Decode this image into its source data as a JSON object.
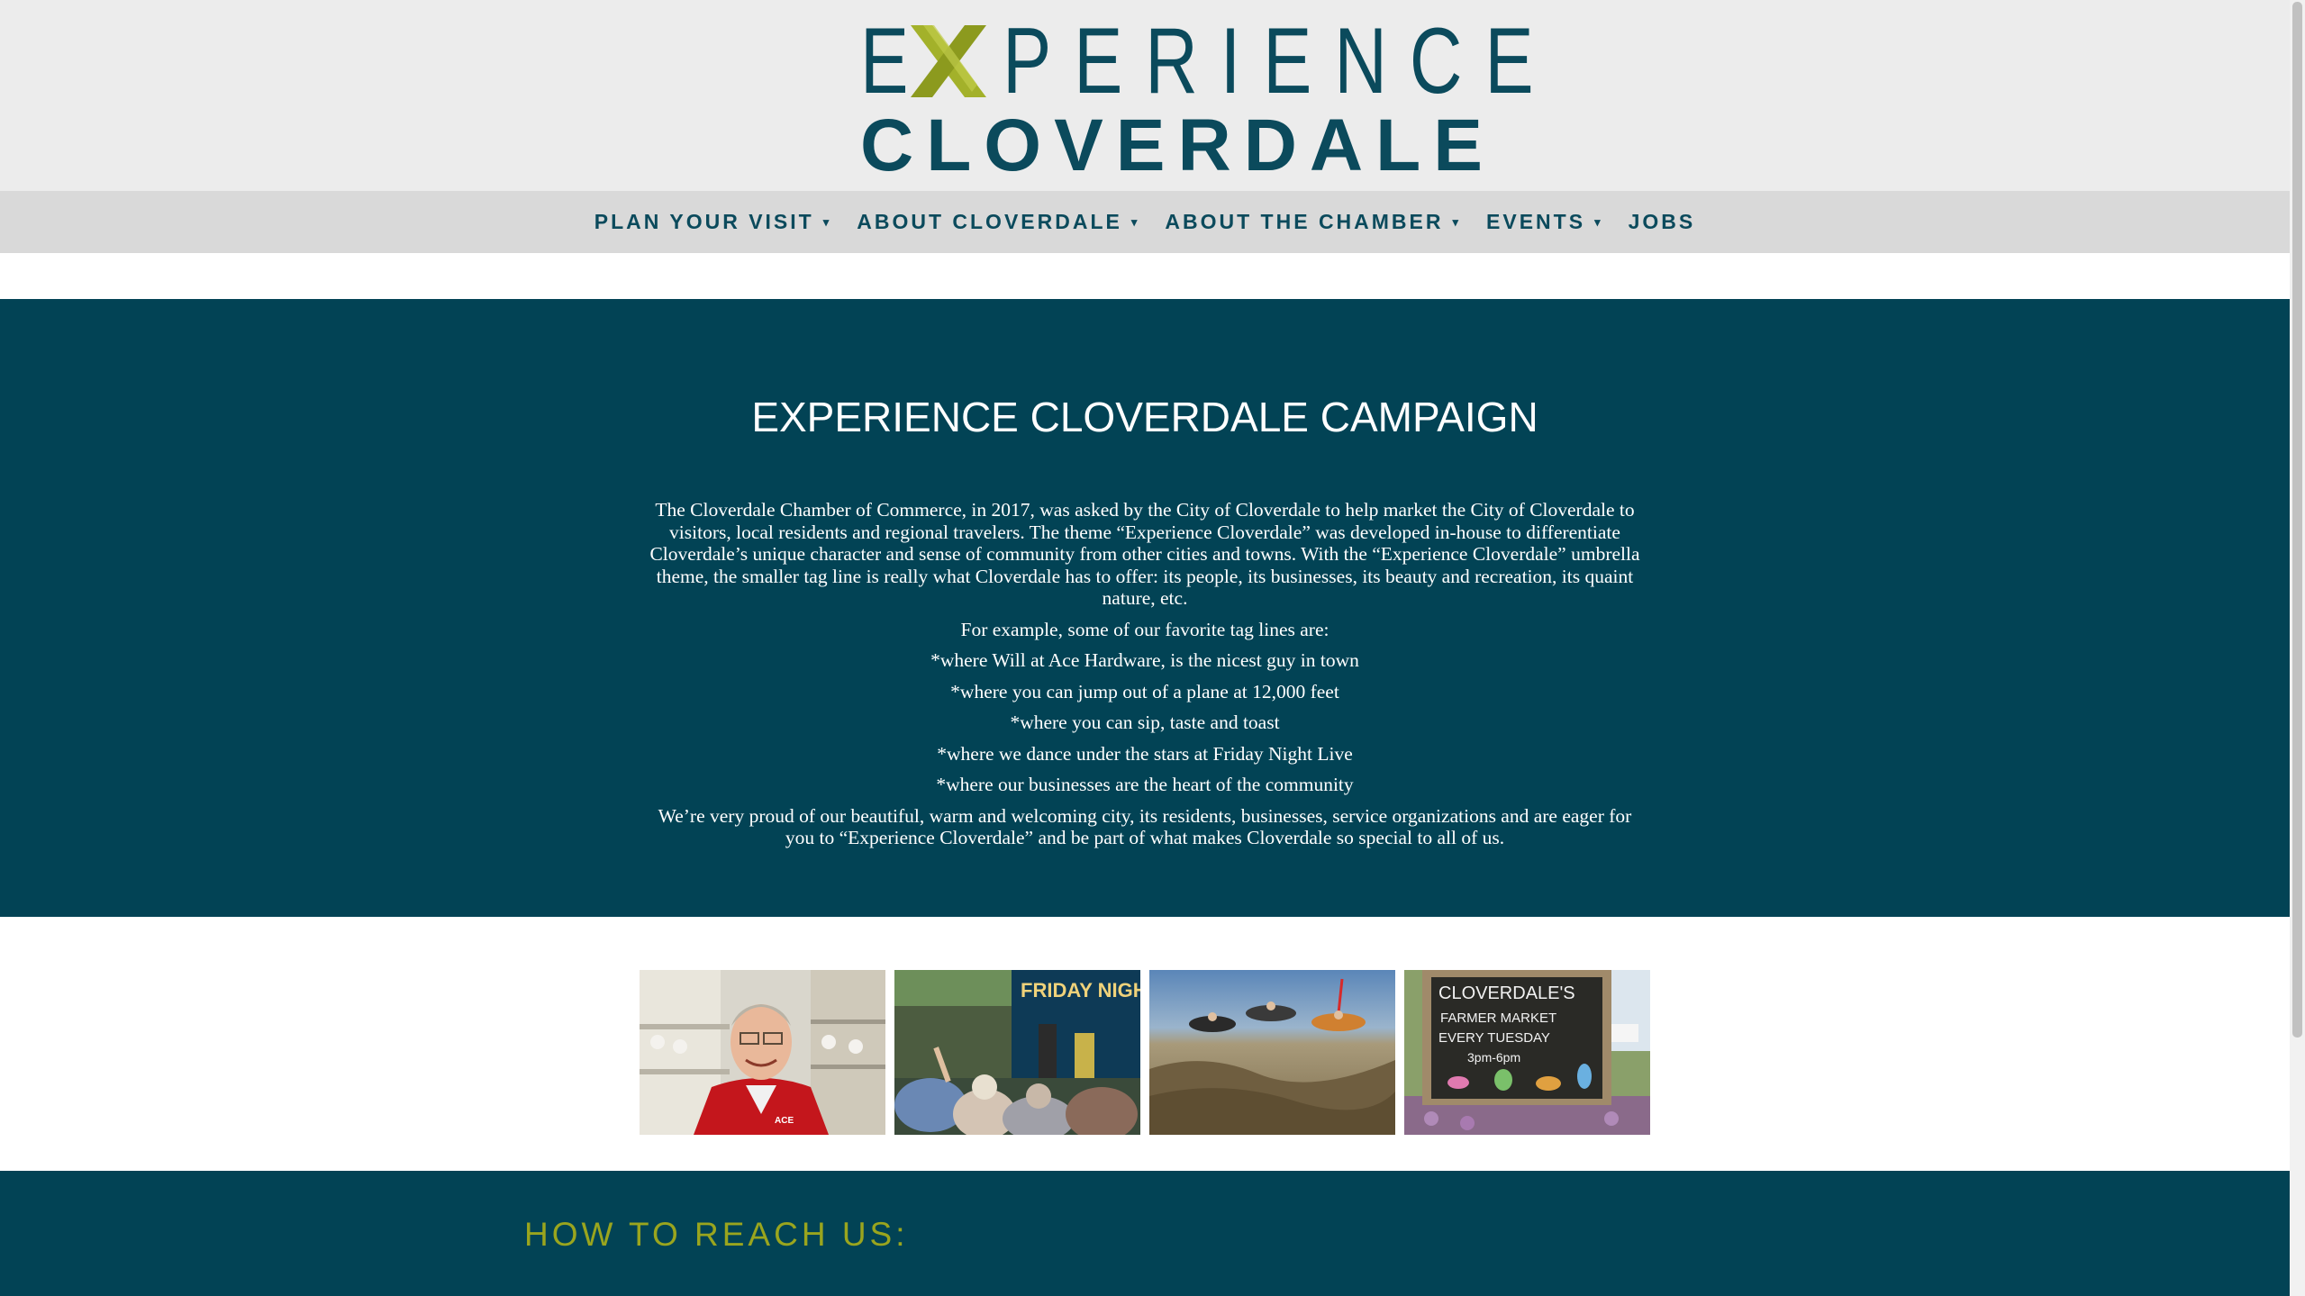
{
  "header": {
    "logo_word_top": "EXPERIENCE",
    "logo_word_bottom": "CLOVERDALE"
  },
  "nav": {
    "items": [
      {
        "label": "PLAN YOUR VISIT",
        "has_dropdown": true
      },
      {
        "label": "ABOUT CLOVERDALE",
        "has_dropdown": true
      },
      {
        "label": "ABOUT THE CHAMBER",
        "has_dropdown": true
      },
      {
        "label": "EVENTS",
        "has_dropdown": true
      },
      {
        "label": "JOBS",
        "has_dropdown": false
      }
    ]
  },
  "campaign": {
    "title": "EXPERIENCE CLOVERDALE CAMPAIGN",
    "paragraphs": [
      "The Cloverdale Chamber of Commerce, in 2017, was asked by the City of Cloverdale to help market the City of Cloverdale to visitors, local residents and regional travelers. The theme “Experience Cloverdale” was developed in-house to differentiate Cloverdale’s unique character and sense of community from other cities and towns. With the “Experience Cloverdale” umbrella theme, the smaller tag line is really what Cloverdale has to offer: its people, its businesses, its beauty and recreation, its quaint nature, etc.",
      "For example, some of our favorite tag lines are:",
      "*where Will at Ace Hardware, is the nicest guy in town",
      "*where you can jump out of a plane at 12,000 feet",
      "*where you can sip, taste and toast",
      "*where we dance under the stars at Friday Night Live",
      "*where our businesses are the heart of the community",
      "We’re very proud of our beautiful, warm and welcoming city, its residents, businesses, service organizations and are eager for you to “Experience Cloverdale” and be part of what makes Cloverdale so special to all of us."
    ]
  },
  "photos": {
    "ace_sign_text": "ACE",
    "friday_banner_text": "FRIDAY NIGHT",
    "market_sign_lines": [
      "CLOVERDALE'S",
      "FARMER MARKET",
      "EVERY TUESDAY",
      "3pm-6pm"
    ]
  },
  "footer": {
    "reach_title": "HOW TO REACH US:"
  },
  "colors": {
    "brand_teal": "#024355",
    "logo_teal": "#0b4a5c",
    "accent_green": "#9aa51e",
    "header_bg": "#ececec",
    "nav_bg": "#d9d9d9"
  },
  "icons": [
    "dropdown-caret-icon",
    "logo-x-mark"
  ]
}
